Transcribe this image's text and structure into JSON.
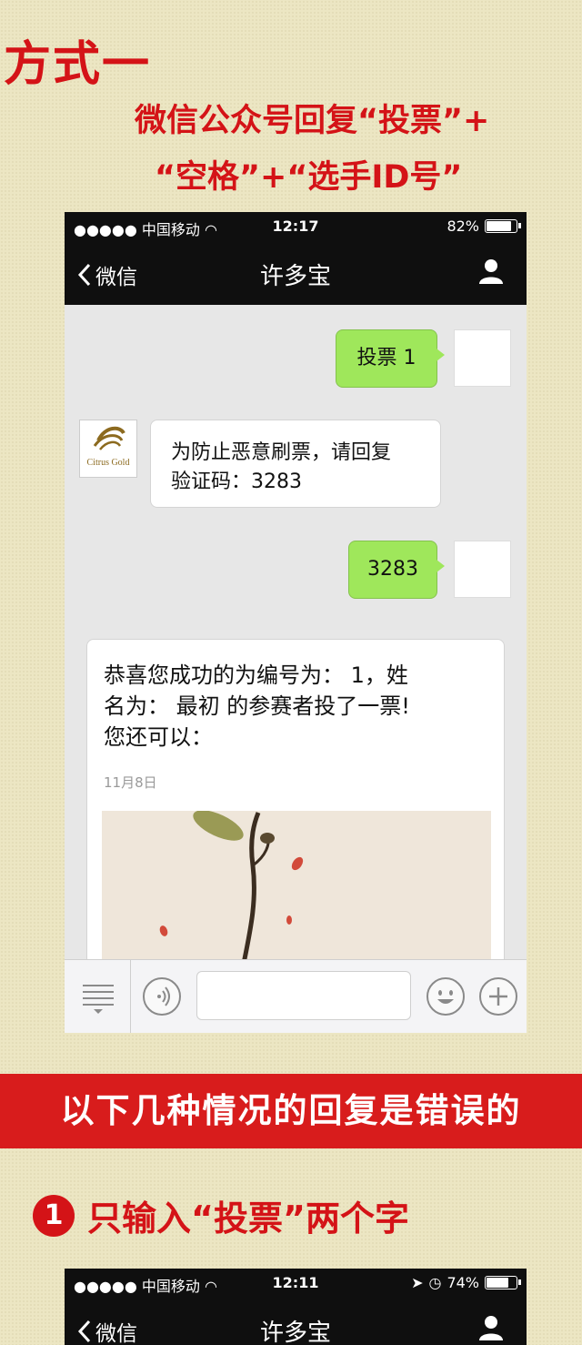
{
  "header": {
    "method_title": "方式一",
    "instruction_line1": "微信公众号回复“投票”+",
    "instruction_line2": "“空格”+“选手ID号”"
  },
  "phone1": {
    "status": {
      "carrier": "●●●●● 中国移动",
      "time": "12:17",
      "battery": "82%",
      "battery_level": 0.82
    },
    "nav": {
      "back_label": "微信",
      "title": "许多宝"
    },
    "messages": {
      "m1": "投票 1",
      "m2_line1": "为防止恶意刷票，请回复",
      "m2_line2": "验证码：3283",
      "m3": "3283",
      "m4_line1": "恭喜您成功的为编号为：  1，姓",
      "m4_line2": "名为：  最初 的参赛者投了一票!",
      "m4_line3": "您还可以：",
      "m4_date": "11月8日"
    },
    "logo_text": "Citrus Gold"
  },
  "error_banner": "以下几种情况的回复是错误的",
  "case1": {
    "number": "1",
    "text": "只输入“投票”两个字"
  },
  "phone2": {
    "status": {
      "carrier": "●●●●● 中国移动",
      "time": "12:11",
      "battery": "74%",
      "battery_level": 0.74
    },
    "nav": {
      "back_label": "微信",
      "title": "许多宝"
    }
  },
  "colors": {
    "heading_red": "#d41317",
    "banner_red": "#d81c1c",
    "bubble_green": "#9fe75b",
    "background": "#ece6c3"
  }
}
